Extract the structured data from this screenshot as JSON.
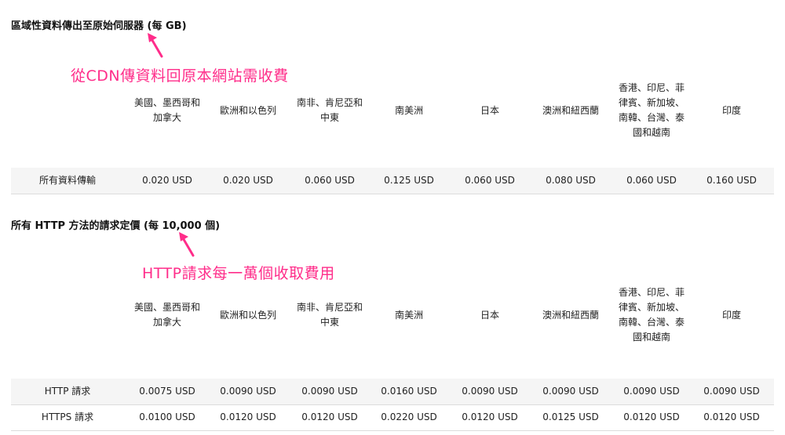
{
  "section1": {
    "title": "區域性資料傳出至原始伺服器 (每 GB)",
    "annotation": "從CDN傳資料回原本網站需收費",
    "headers": [
      "美國、墨西哥和加拿大",
      "歐洲和以色列",
      "南非、肯尼亞和中東",
      "南美洲",
      "日本",
      "澳洲和紐西蘭",
      "香港、印尼、菲律賓、新加坡、南韓、台灣、泰國和越南",
      "印度"
    ],
    "rows": [
      {
        "label": "所有資料傳輸",
        "values": [
          "0.020 USD",
          "0.020 USD",
          "0.060 USD",
          "0.125 USD",
          "0.060 USD",
          "0.080 USD",
          "0.060 USD",
          "0.160 USD"
        ]
      }
    ]
  },
  "section2": {
    "title": "所有 HTTP 方法的請求定價 (每 10,000 個)",
    "annotation": "HTTP請求每一萬個收取費用",
    "headers": [
      "美國、墨西哥和加拿大",
      "歐洲和以色列",
      "南非、肯尼亞和中東",
      "南美洲",
      "日本",
      "澳洲和紐西蘭",
      "香港、印尼、菲律賓、新加坡、南韓、台灣、泰國和越南",
      "印度"
    ],
    "rows": [
      {
        "label": "HTTP 請求",
        "values": [
          "0.0075 USD",
          "0.0090 USD",
          "0.0090 USD",
          "0.0160 USD",
          "0.0090 USD",
          "0.0090 USD",
          "0.0090 USD",
          "0.0090 USD"
        ]
      },
      {
        "label": "HTTPS 請求",
        "values": [
          "0.0100 USD",
          "0.0120 USD",
          "0.0120 USD",
          "0.0220 USD",
          "0.0120 USD",
          "0.0125 USD",
          "0.0120 USD",
          "0.0120 USD"
        ]
      }
    ]
  },
  "colors": {
    "annotation": "#ff2d8a",
    "row_shade": "#f5f5f5",
    "divider": "#dcdcdc"
  },
  "icons": [
    "annotation-arrow-icon"
  ]
}
